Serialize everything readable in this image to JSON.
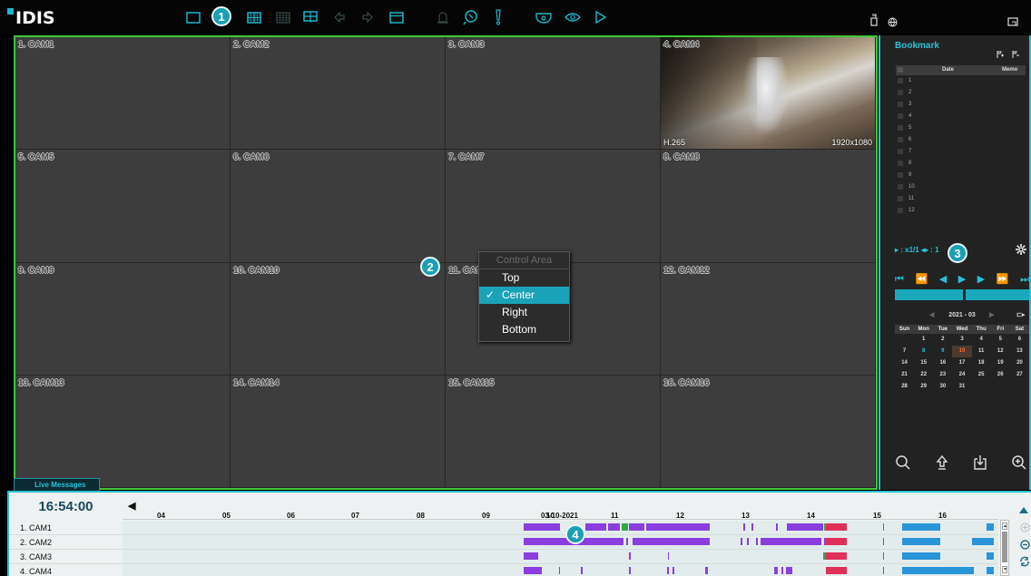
{
  "app": {
    "logo_text": "IDIS"
  },
  "toolbar": {
    "icons": [
      "single-view-icon",
      "layout-2x2-icon",
      "layout-4x4-icon",
      "layout-custom-icon",
      "prev-group-icon",
      "next-group-icon",
      "fullscreen-icon",
      "alarm-icon",
      "ptz-icon",
      "event-icon",
      "fisheye-icon",
      "view-icon",
      "playback-icon"
    ],
    "right_icons": [
      "usb-icon",
      "globe-icon",
      "window-icon"
    ]
  },
  "callouts": [
    "1",
    "2",
    "3",
    "4"
  ],
  "cameras": [
    {
      "label": "1. CAM1"
    },
    {
      "label": "2. CAM2"
    },
    {
      "label": "3. CAM3"
    },
    {
      "label": "4. CAM4",
      "codec": "H.265",
      "resolution": "1920x1080"
    },
    {
      "label": "5. CAM5"
    },
    {
      "label": "6. CAM6"
    },
    {
      "label": "7. CAM7"
    },
    {
      "label": "8. CAM8"
    },
    {
      "label": "9. CAM9"
    },
    {
      "label": "10. CAM10"
    },
    {
      "label": "11. CAM11"
    },
    {
      "label": "12. CAM12"
    },
    {
      "label": "13. CAM13"
    },
    {
      "label": "14. CAM14"
    },
    {
      "label": "15. CAM15"
    },
    {
      "label": "16. CAM16"
    }
  ],
  "context_menu": {
    "header": "Control Area",
    "items": [
      {
        "label": "Top",
        "checked": false
      },
      {
        "label": "Center",
        "checked": true
      },
      {
        "label": "Right",
        "checked": false
      },
      {
        "label": "Bottom",
        "checked": false
      }
    ]
  },
  "bookmark": {
    "title": "Bookmark",
    "col_date": "Date",
    "col_memo": "Memo",
    "rows": [
      "1",
      "2",
      "3",
      "4",
      "5",
      "6",
      "7",
      "8",
      "9",
      "10",
      "11",
      "12"
    ]
  },
  "playback": {
    "speed_text": "x1/1"
  },
  "calendar": {
    "month": "2021 - 03",
    "weekdays": [
      "Sun",
      "Mon",
      "Tue",
      "Wed",
      "Thu",
      "Fri",
      "Sat"
    ],
    "weeks": [
      [
        "",
        "1",
        "2",
        "3",
        "4",
        "5",
        "6"
      ],
      [
        "7",
        "8",
        "9",
        "10",
        "11",
        "12",
        "13"
      ],
      [
        "14",
        "15",
        "16",
        "17",
        "18",
        "19",
        "20"
      ],
      [
        "21",
        "22",
        "23",
        "24",
        "25",
        "26",
        "27"
      ],
      [
        "28",
        "29",
        "30",
        "31",
        "",
        "",
        ""
      ]
    ],
    "recorded_days": [
      "8",
      "9"
    ],
    "selected_day": "10"
  },
  "live_messages": {
    "label": "Live Messages"
  },
  "timeline": {
    "clock": "16:54:00",
    "date": "03-10-2021",
    "hours": [
      "04",
      "05",
      "06",
      "07",
      "08",
      "09",
      "10",
      "11",
      "12",
      "13",
      "14",
      "15",
      "16"
    ],
    "channels": [
      "1. CAM1",
      "2. CAM2",
      "3. CAM3",
      "4. CAM4"
    ],
    "colors": {
      "continuous": "#8a3ee0",
      "event": "#e0305a",
      "motion": "#2a94d8",
      "alarm": "#2fa84a",
      "accent": "#17b6cc"
    }
  }
}
